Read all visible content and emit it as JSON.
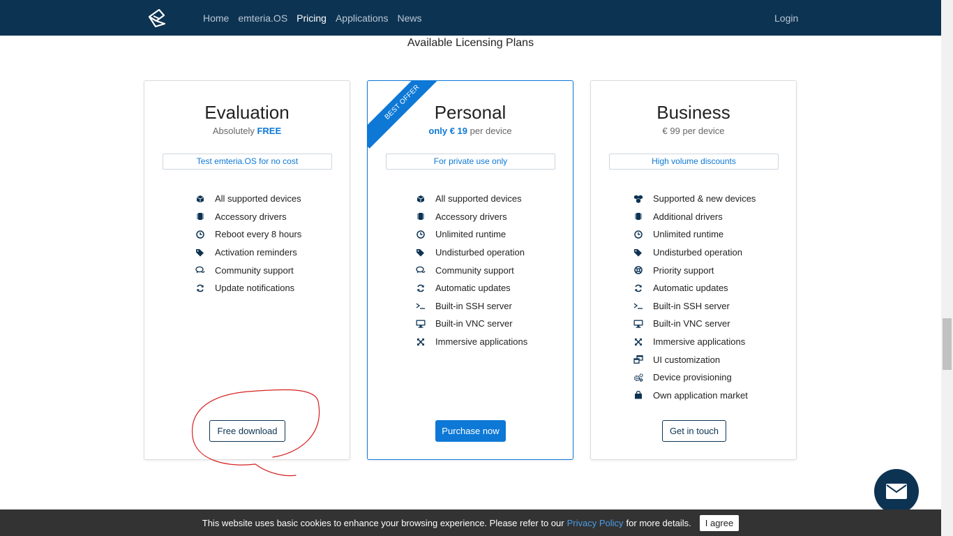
{
  "nav": {
    "logo_icon": "emteria-logo-icon",
    "links": [
      {
        "label": "Home",
        "active": false
      },
      {
        "label": "emteria.OS",
        "active": false
      },
      {
        "label": "Pricing",
        "active": true
      },
      {
        "label": "Applications",
        "active": false
      },
      {
        "label": "News",
        "active": false
      }
    ],
    "login_label": "Login"
  },
  "section_title": "Available Licensing Plans",
  "plans": {
    "evaluation": {
      "title": "Evaluation",
      "sub_prefix": "Absolutely",
      "sub_highlight": "FREE",
      "sub_suffix": "",
      "tagline": "Test emteria.OS for no cost",
      "features": [
        {
          "icon": "cube-icon",
          "label": "All supported devices"
        },
        {
          "icon": "chip-icon",
          "label": "Accessory drivers"
        },
        {
          "icon": "clock-icon",
          "label": "Reboot every 8 hours"
        },
        {
          "icon": "tags-icon",
          "label": "Activation reminders"
        },
        {
          "icon": "comments-icon",
          "label": "Community support"
        },
        {
          "icon": "sync-icon",
          "label": "Update notifications"
        }
      ],
      "button_label": "Free download"
    },
    "personal": {
      "ribbon": "BEST OFFER",
      "title": "Personal",
      "sub_prefix": "",
      "sub_highlight": "only € 19",
      "sub_suffix": " per device",
      "tagline": "For private use only",
      "features": [
        {
          "icon": "cube-icon",
          "label": "All supported devices"
        },
        {
          "icon": "chip-icon",
          "label": "Accessory drivers"
        },
        {
          "icon": "clock-icon",
          "label": "Unlimited runtime"
        },
        {
          "icon": "tags-icon",
          "label": "Undisturbed operation"
        },
        {
          "icon": "comments-icon",
          "label": "Community support"
        },
        {
          "icon": "sync-icon",
          "label": "Automatic updates"
        },
        {
          "icon": "terminal-icon",
          "label": "Built-in SSH server"
        },
        {
          "icon": "desktop-icon",
          "label": "Built-in VNC server"
        },
        {
          "icon": "expand-icon",
          "label": "Immersive applications"
        }
      ],
      "button_label": "Purchase now"
    },
    "business": {
      "title": "Business",
      "sub_prefix": "",
      "sub_highlight": "",
      "sub_suffix": "€ 99 per device",
      "tagline": "High volume discounts",
      "features": [
        {
          "icon": "cubes-icon",
          "label": "Supported & new devices"
        },
        {
          "icon": "chip-icon",
          "label": "Additional drivers"
        },
        {
          "icon": "clock-icon",
          "label": "Unlimited runtime"
        },
        {
          "icon": "tags-icon",
          "label": "Undisturbed operation"
        },
        {
          "icon": "lifebuoy-icon",
          "label": "Priority support"
        },
        {
          "icon": "sync-icon",
          "label": "Automatic updates"
        },
        {
          "icon": "terminal-icon",
          "label": "Built-in SSH server"
        },
        {
          "icon": "desktop-icon",
          "label": "Built-in VNC server"
        },
        {
          "icon": "expand-icon",
          "label": "Immersive applications"
        },
        {
          "icon": "windows-icon",
          "label": "UI customization"
        },
        {
          "icon": "cogs-icon",
          "label": "Device provisioning"
        },
        {
          "icon": "shopping-bag-icon",
          "label": "Own application market"
        }
      ],
      "button_label": "Get in touch"
    }
  },
  "chat_icon": "envelope-icon",
  "cookie": {
    "text_before": "This website uses basic cookies to enhance your browsing experience. Please refer to our",
    "link_label": "Privacy Policy",
    "text_after": "for more details.",
    "agree_label": "I agree"
  },
  "colors": {
    "navbar": "#0d3353",
    "accent": "#0d78d6",
    "annotation": "#d62020",
    "cookie_bar": "#333333"
  }
}
